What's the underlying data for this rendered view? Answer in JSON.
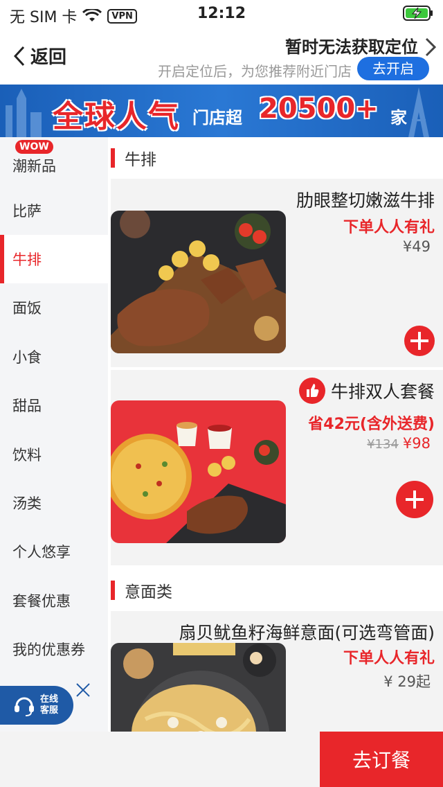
{
  "status_bar": {
    "carrier": "无 SIM 卡",
    "vpn": "VPN",
    "time": "12:12"
  },
  "nav": {
    "back_label": "返回",
    "location_title": "暂时无法获取定位",
    "location_subtitle": "开启定位后，为您推荐附近门店",
    "location_button": "去开启"
  },
  "banner": {
    "text_big": "全球人气",
    "text_mid": "门店超",
    "text_num": "20500+",
    "text_end": "家"
  },
  "sidebar": {
    "badge": "WOW",
    "items": [
      {
        "label": "潮新品"
      },
      {
        "label": "比萨"
      },
      {
        "label": "牛排"
      },
      {
        "label": "面饭"
      },
      {
        "label": "小食"
      },
      {
        "label": "甜品"
      },
      {
        "label": "饮料"
      },
      {
        "label": "汤类"
      },
      {
        "label": "个人悠享"
      },
      {
        "label": "套餐优惠"
      },
      {
        "label": "我的优惠券"
      }
    ],
    "active_index": 2
  },
  "service": {
    "label_line1": "在线",
    "label_line2": "客服"
  },
  "sections": [
    {
      "title": "牛排",
      "items": [
        {
          "name": "肋眼整切嫩滋牛排",
          "promo": "下单人人有礼",
          "price": "¥49"
        },
        {
          "name": "牛排双人套餐",
          "promo": "省42元(含外送费)",
          "old_price": "¥134",
          "price": "¥98"
        }
      ]
    },
    {
      "title": "意面类",
      "items": [
        {
          "name": "扇贝鱿鱼籽海鲜意面(可选弯管面)",
          "promo": "下单人人有礼",
          "price": "¥ 29起"
        }
      ]
    }
  ],
  "bottom": {
    "order_button": "去订餐"
  },
  "colors": {
    "accent": "#e8262a",
    "brand_blue": "#1e6fe0"
  }
}
